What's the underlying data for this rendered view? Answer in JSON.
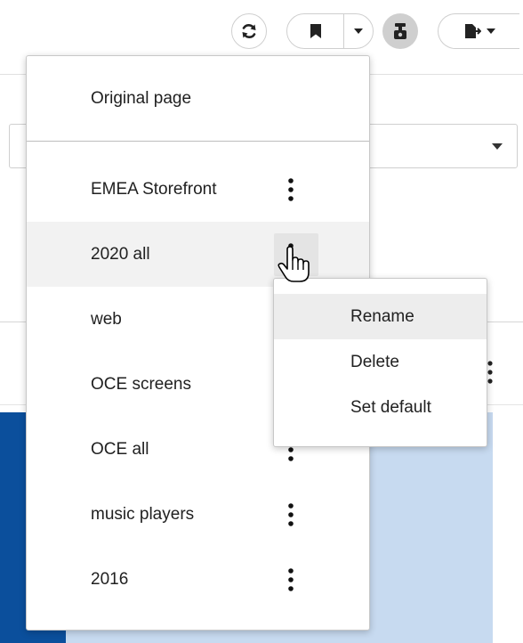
{
  "toolbar": {
    "icons": {
      "refresh": "refresh-icon",
      "bookmark": "bookmark-icon",
      "bookmark_menu": "chevron-down-icon",
      "hand_pointer": "hand-pointer-icon",
      "export": "export-icon",
      "export_menu": "chevron-down-icon"
    }
  },
  "menu": {
    "original_page": "Original page",
    "items": [
      {
        "label": "EMEA Storefront"
      },
      {
        "label": "2020 all"
      },
      {
        "label": "web"
      },
      {
        "label": "OCE screens"
      },
      {
        "label": "OCE all"
      },
      {
        "label": "music players"
      },
      {
        "label": "2016"
      }
    ],
    "hovered_item": "2020 all"
  },
  "submenu": {
    "items": [
      {
        "label": "Rename"
      },
      {
        "label": "Delete"
      },
      {
        "label": "Set default"
      }
    ],
    "hovered_item": "Rename"
  },
  "colors": {
    "chart_dark_blue": "#0b4f9c",
    "chart_light_blue": "#c7daf0",
    "hover_gray": "#f2f2f2",
    "active_button_gray": "#cfcfcf"
  }
}
